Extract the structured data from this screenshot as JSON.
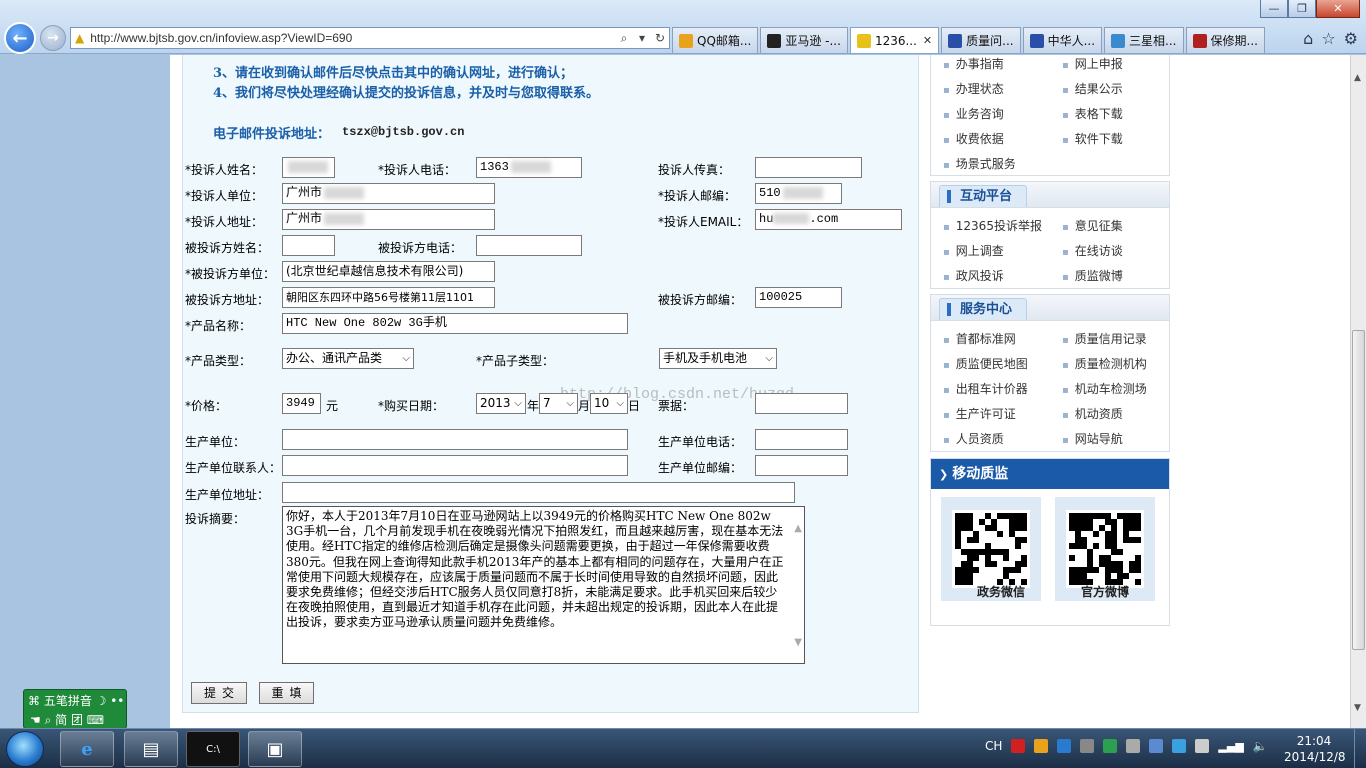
{
  "browser": {
    "address": "http://www.bjtsb.gov.cn/infoview.asp?ViewID=690",
    "tabs": [
      {
        "label": "QQ邮箱...",
        "color": "#e8a21b"
      },
      {
        "label": "亚马逊 -...",
        "color": "#222222"
      },
      {
        "label": "1236...",
        "color": "#e8c21b"
      },
      {
        "label": "质量问...",
        "color": "#2a4fa8"
      },
      {
        "label": "中华人...",
        "color": "#2a4fa8"
      },
      {
        "label": "三星相...",
        "color": "#3a8ad0"
      },
      {
        "label": "保修期...",
        "color": "#b02020"
      }
    ]
  },
  "notice": {
    "line3": "3、请在收到确认邮件后尽快点击其中的确认网址，进行确认；",
    "line4": "4、我们将尽快处理经确认提交的投诉信息，并及时与您取得联系。",
    "email_label": "电子邮件投诉地址：",
    "email_value": "tszx@bjtsb.gov.cn"
  },
  "form": {
    "complainant_name_label": "*投诉人姓名：",
    "complainant_phone_label": "*投诉人电话：",
    "complainant_phone_value": "1363",
    "complainant_fax_label": "投诉人传真：",
    "complainant_unit_label": "*投诉人单位：",
    "complainant_unit_value": "广州市",
    "complainant_zip_label": "*投诉人邮编：",
    "complainant_zip_value": "510",
    "complainant_addr_label": "*投诉人地址：",
    "complainant_addr_value": "广州市",
    "complainant_email_label": "*投诉人EMAIL：",
    "complainant_email_value": "hu",
    "complainant_email_suffix": ".com",
    "respondent_name_label": "被投诉方姓名：",
    "respondent_phone_label": "被投诉方电话：",
    "respondent_unit_label": "*被投诉方单位：",
    "respondent_unit_value": "(北京世纪卓越信息技术有限公司)",
    "respondent_addr_label": "被投诉方地址：",
    "respondent_addr_value": "朝阳区东四环中路56号楼第11层1101",
    "respondent_zip_label": "被投诉方邮编：",
    "respondent_zip_value": "100025",
    "product_name_label": "*产品名称：",
    "product_name_value": "HTC New One 802w 3G手机",
    "product_type_label": "*产品类型：",
    "product_type_value": "办公、通讯产品类",
    "product_subtype_label": "*产品子类型：",
    "product_subtype_value": "手机及手机电池",
    "price_label": "*价格：",
    "price_value": "3949",
    "price_unit": "元",
    "purchase_date_label": "*购买日期：",
    "year_value": "2013",
    "year_unit": "年",
    "month_value": "7",
    "month_unit": "月",
    "day_value": "10",
    "day_unit": "日",
    "receipt_label": "票据：",
    "maker_label": "生产单位：",
    "maker_phone_label": "生产单位电话：",
    "maker_contact_label": "生产单位联系人：",
    "maker_zip_label": "生产单位邮编：",
    "maker_addr_label": "生产单位地址：",
    "summary_label": "投诉摘要：",
    "summary_value": "你好，本人于2013年7月10日在亚马逊网站上以3949元的价格购买HTC New One 802w 3G手机一台，几个月前发现手机在夜晚弱光情况下拍照发红，而且越来越厉害，现在基本无法使用。经HTC指定的维修店检测后确定是摄像头问题需要更换，由于超过一年保修需要收费380元。但我在网上查询得知此款手机2013年产的基本上都有相同的问题存在，大量用户在正常使用下问题大规模存在，应该属于质量问题而不属于长时间使用导致的自然损坏问题，因此要求免费维修；但经交涉后HTC服务人员仅同意打8折，未能满足要求。此手机买回来后较少在夜晚拍照使用，直到最近才知道手机存在此问题，并未超出规定的投诉期，因此本人在此提出投诉，要求卖方亚马逊承认质量问题并免费维修。",
    "submit_label": "提交",
    "reset_label": "重填",
    "watermark": "http://blog.csdn.net/huzgd"
  },
  "sidebar": {
    "top_items": [
      "办事指南",
      "网上申报",
      "办理状态",
      "结果公示",
      "业务咨询",
      "表格下载",
      "收费依据",
      "软件下载",
      "场景式服务"
    ],
    "interactive_title": "互动平台",
    "interactive_items": [
      "12365投诉举报",
      "意见征集",
      "网上调查",
      "在线访谈",
      "政风投诉",
      "质监微博"
    ],
    "service_title": "服务中心",
    "service_items": [
      "首都标准网",
      "质量信用记录",
      "质监便民地图",
      "质量检测机构",
      "出租车计价器",
      "机动车检测场",
      "生产许可证",
      "机动资质",
      "人员资质",
      "网站导航"
    ],
    "mobile_title": "移动质监",
    "qr_left_caption": "政务微信",
    "qr_right_caption": "官方微博"
  },
  "ime": {
    "top": "五笔拼音",
    "bottom": "简 团"
  },
  "taskbar": {
    "lang": "CH",
    "time": "21:04",
    "date": "2014/12/8"
  }
}
